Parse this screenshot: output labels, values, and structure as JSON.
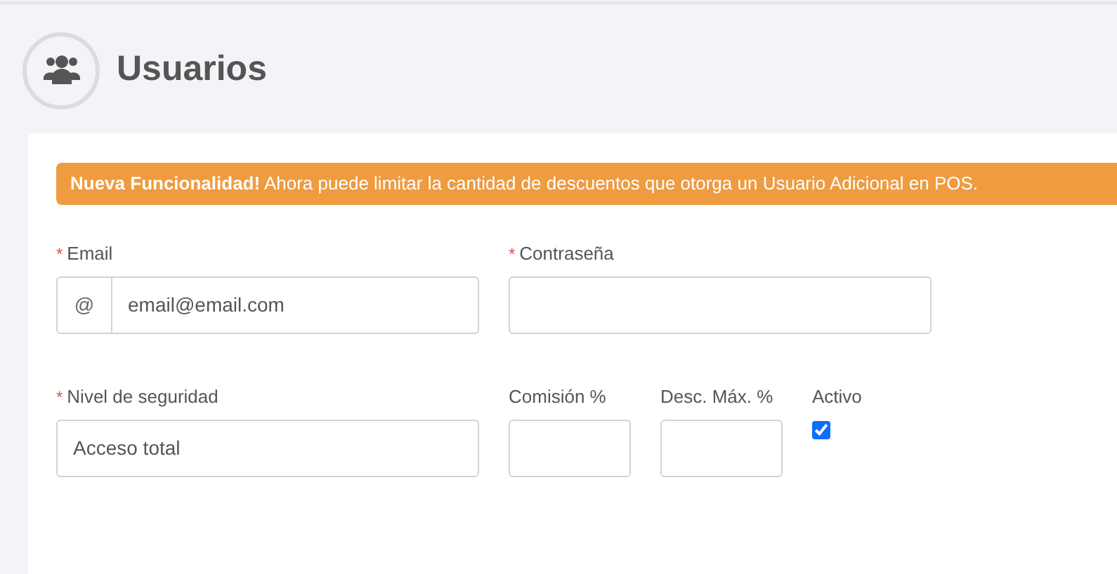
{
  "page": {
    "title": "Usuarios"
  },
  "alert": {
    "text": "**Nueva Funcionalidad!** Ahora puede limitar la cantidad de descuentos que otorga un Usuario Adicional en POS."
  },
  "rows": [
    [
      {
        "kind": "text",
        "label": "Email",
        "required_mark": "*",
        "prefix": "@",
        "value": "email@email.com"
      },
      {
        "kind": "password",
        "label": "Contraseña",
        "required_mark": "*"
      }
    ],
    [
      {
        "kind": "text",
        "label": "Nivel de seguridad",
        "required_mark": "*",
        "value": "Acceso total"
      },
      {
        "kind": "number",
        "label": "Comisión %"
      },
      {
        "kind": "number",
        "label": "Desc. Máx. %"
      },
      {
        "kind": "checkbox",
        "label": "Activo",
        "checked": true
      }
    ]
  ]
}
